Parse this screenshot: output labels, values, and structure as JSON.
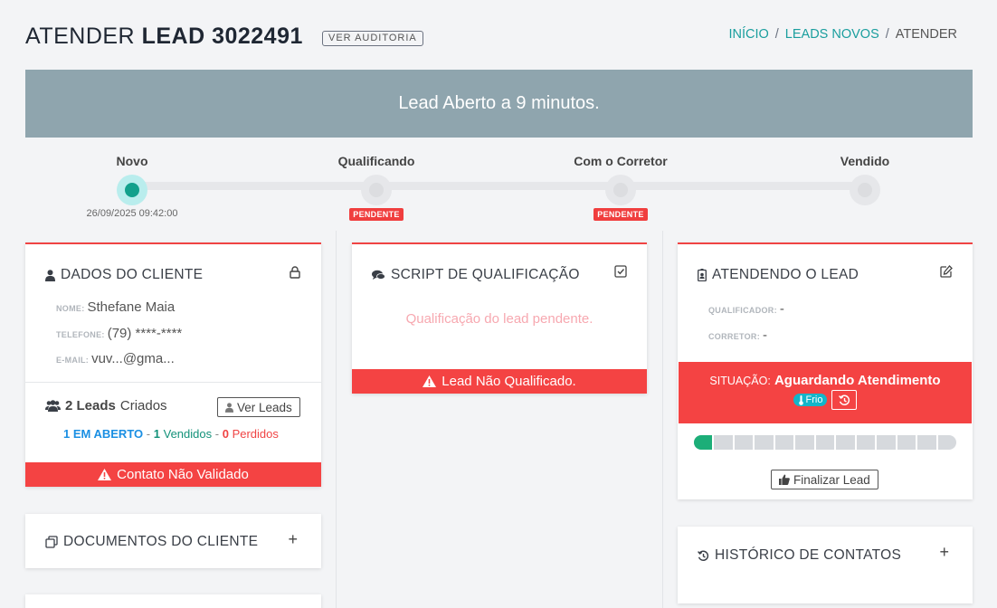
{
  "header": {
    "title_prefix": "ATENDER",
    "title_lead": "LEAD 3022491",
    "audit_button": "VER AUDITORIA",
    "breadcrumb": {
      "home": "INÍCIO",
      "sep": "/",
      "leads": "LEADS NOVOS",
      "current": "ATENDER"
    }
  },
  "banner": {
    "text": "Lead Aberto a 9 minutos."
  },
  "steps": [
    {
      "label": "Novo",
      "date": "26/09/2025 09:42:00",
      "status": "active"
    },
    {
      "label": "Qualificando",
      "badge": "PENDENTE",
      "status": "pending"
    },
    {
      "label": "Com o Corretor",
      "badge": "PENDENTE",
      "status": "pending"
    },
    {
      "label": "Vendido",
      "status": "inactive"
    }
  ],
  "client": {
    "title": "DADOS DO CLIENTE",
    "name_label": "NOME:",
    "name": "Sthefane Maia",
    "phone_label": "TELEFONE:",
    "phone": "(79) ****-****",
    "email_label": "E-MAIL:",
    "email": "vuv...@gma...",
    "leads_count": "2 Leads",
    "leads_suffix": "Criados",
    "view_leads_button": "Ver Leads",
    "open_count": "1",
    "open_label": "EM ABERTO",
    "dash": "-",
    "sold_count": "1",
    "sold_label": "Vendidos",
    "lost_count": "0",
    "lost_label": "Perdidos",
    "warning": "Contato Não Validado"
  },
  "documents": {
    "title": "DOCUMENTOS DO CLIENTE",
    "add": "+"
  },
  "script": {
    "title": "SCRIPT DE QUALIFICAÇÃO",
    "pending_text": "Qualificação do lead pendente.",
    "warning": "Lead Não Qualificado."
  },
  "attending": {
    "title": "ATENDENDO O LEAD",
    "qualifier_label": "QUALIFICADOR:",
    "qualifier": "-",
    "broker_label": "CORRETOR:",
    "broker": "-",
    "situation_label": "SITUAÇÃO:",
    "situation": "Aguardando Atendimento",
    "temperature": "Frio",
    "progress_segments": 13,
    "progress_filled": 1,
    "finalize_button": "Finalizar Lead"
  },
  "history": {
    "title": "HISTÓRICO DE CONTATOS",
    "add": "+"
  },
  "colors": {
    "accent_teal": "#1a9e9e",
    "danger": "#f44343",
    "banner": "#8fa5ae",
    "info_blue": "#1a8fe3",
    "success": "#1cae78"
  }
}
